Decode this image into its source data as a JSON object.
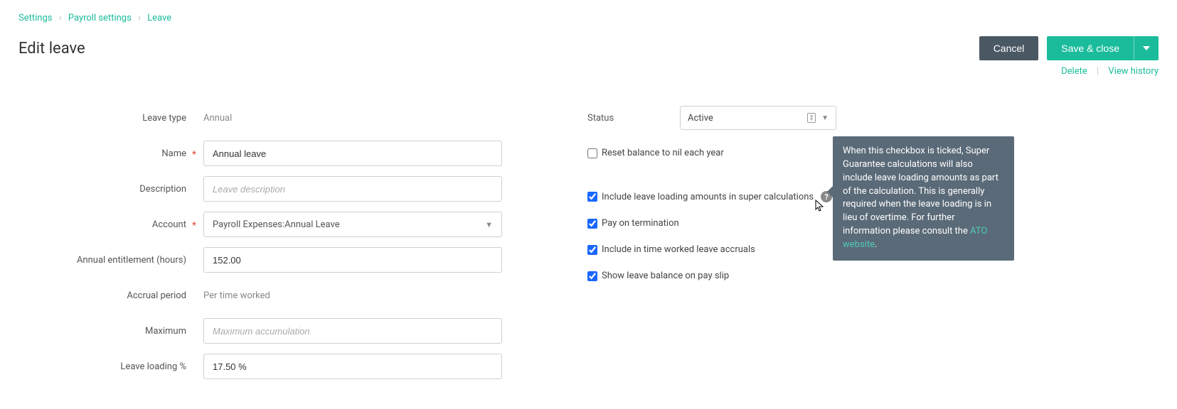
{
  "breadcrumb": {
    "settings": "Settings",
    "payroll": "Payroll settings",
    "leave": "Leave"
  },
  "page_title": "Edit leave",
  "buttons": {
    "cancel": "Cancel",
    "save": "Save & close"
  },
  "links": {
    "delete": "Delete",
    "history": "View history"
  },
  "form": {
    "leave_type_label": "Leave type",
    "leave_type_value": "Annual",
    "name_label": "Name",
    "name_value": "Annual leave",
    "description_label": "Description",
    "description_placeholder": "Leave description",
    "account_label": "Account",
    "account_value": "Payroll Expenses:Annual Leave",
    "entitlement_label": "Annual entitlement (hours)",
    "entitlement_value": "152.00",
    "accrual_label": "Accrual period",
    "accrual_value": "Per time worked",
    "maximum_label": "Maximum",
    "maximum_placeholder": "Maximum accumulation",
    "loading_label": "Leave loading %",
    "loading_value": "17.50 %"
  },
  "right": {
    "status_label": "Status",
    "status_value": "Active",
    "reset_balance": "Reset balance to nil each year",
    "include_super": "Include leave loading amounts in super calculations",
    "pay_termination": "Pay on termination",
    "include_accruals": "Include in time worked leave accruals",
    "show_balance": "Show leave balance on pay slip"
  },
  "tooltip": {
    "text": "When this checkbox is ticked, Super Guarantee calculations will also include leave loading amounts as part of the calculation. This is generally required when the leave loading is in lieu of overtime. For further information please consult the ",
    "link": "ATO website",
    "period": "."
  }
}
